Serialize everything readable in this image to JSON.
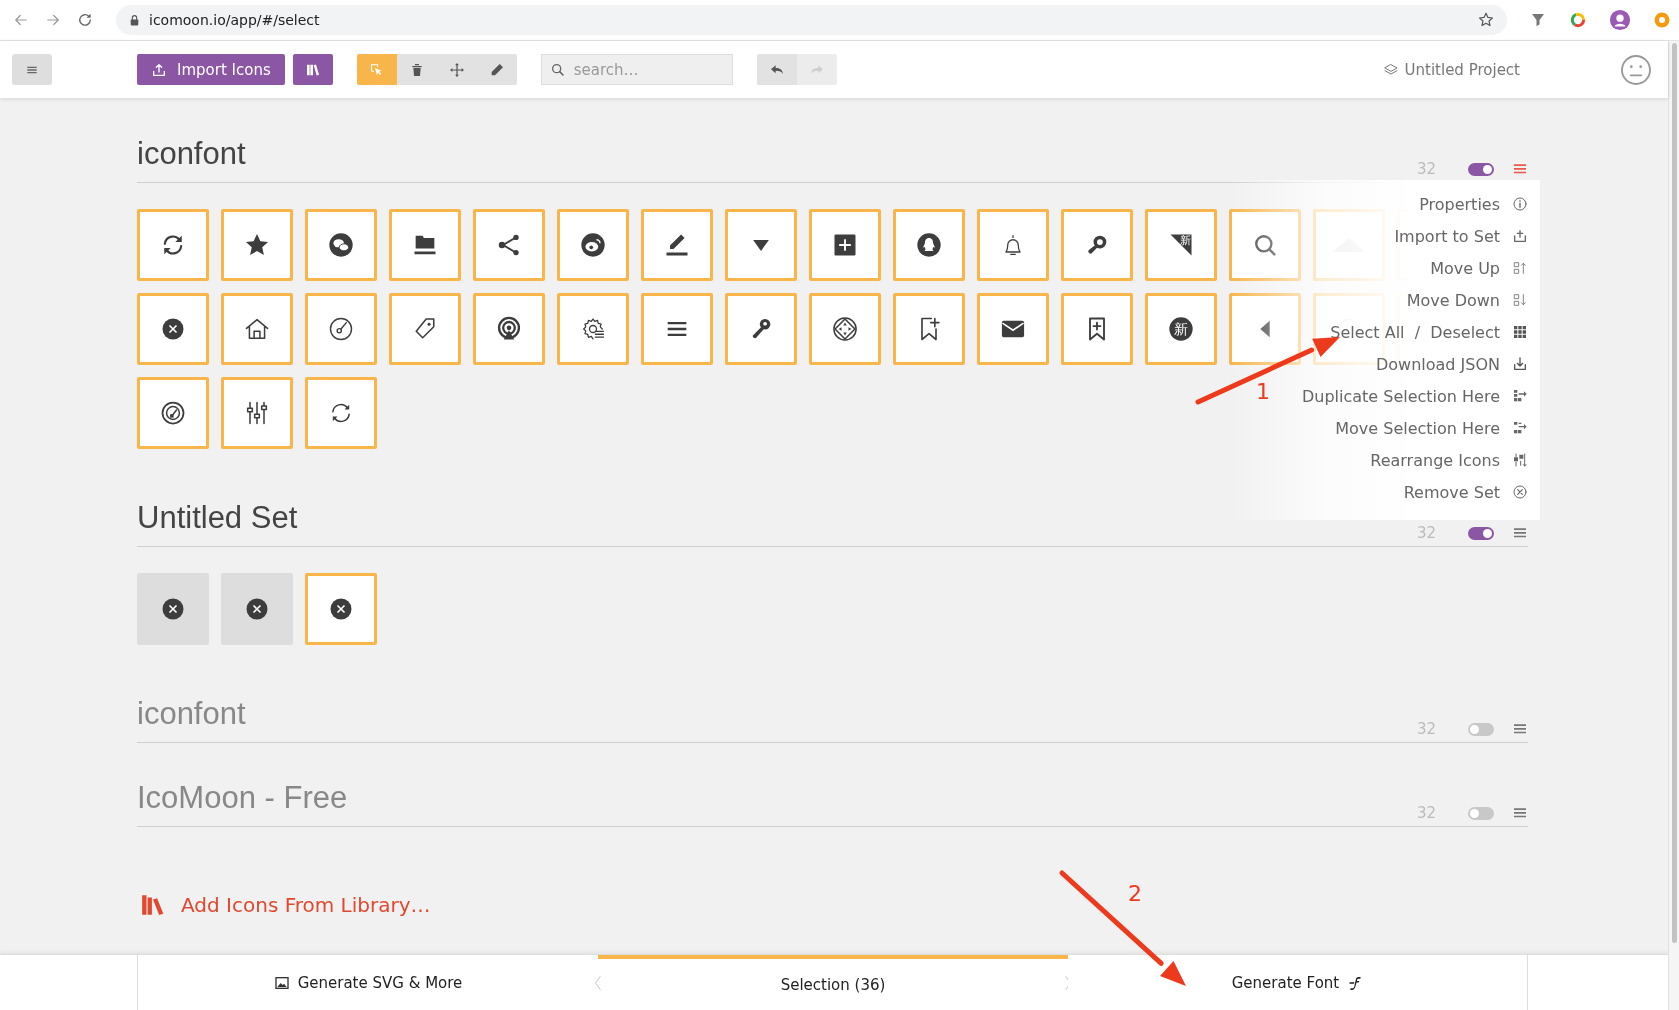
{
  "browser": {
    "url": "icomoon.io/app/#/select"
  },
  "toolbar": {
    "import_label": "Import Icons",
    "tools": [
      {
        "kind": "select",
        "selected": true
      },
      {
        "kind": "trash",
        "selected": false
      },
      {
        "kind": "move",
        "selected": false
      },
      {
        "kind": "edit",
        "selected": false
      }
    ],
    "search": {
      "placeholder": "search…"
    },
    "history": [
      {
        "kind": "undo",
        "disabled": false
      },
      {
        "kind": "redo",
        "disabled": true
      }
    ],
    "project": "Untitled Project"
  },
  "sets": [
    {
      "title": "iconfont",
      "count": "32",
      "enabled": true,
      "menu_open": true,
      "icons": [
        {
          "kind": "refresh",
          "selected": true
        },
        {
          "kind": "star",
          "selected": true
        },
        {
          "kind": "chat",
          "selected": true
        },
        {
          "kind": "inbox",
          "selected": true
        },
        {
          "kind": "share",
          "selected": true
        },
        {
          "kind": "weibo",
          "selected": true
        },
        {
          "kind": "editline",
          "selected": true
        },
        {
          "kind": "caretdown",
          "selected": true
        },
        {
          "kind": "plusbox",
          "selected": true
        },
        {
          "kind": "qq",
          "selected": true
        },
        {
          "kind": "bell",
          "selected": true
        },
        {
          "kind": "keysearch",
          "selected": true
        },
        {
          "kind": "corner",
          "glyph": "新",
          "selected": true
        },
        {
          "kind": "search",
          "selected": true
        },
        {
          "kind": "triup",
          "selected": true
        },
        {
          "kind": "covered",
          "selected": true
        },
        {
          "kind": "closecircle",
          "selected": true
        },
        {
          "kind": "home",
          "selected": true
        },
        {
          "kind": "gauge",
          "selected": true
        },
        {
          "kind": "tag",
          "selected": true
        },
        {
          "kind": "broadcast",
          "selected": true
        },
        {
          "kind": "gearlist",
          "selected": true
        },
        {
          "kind": "menu",
          "selected": true
        },
        {
          "kind": "key",
          "selected": true
        },
        {
          "kind": "compass",
          "selected": true
        },
        {
          "kind": "bookplus",
          "selected": true
        },
        {
          "kind": "mail",
          "selected": true
        },
        {
          "kind": "bookbox",
          "selected": true
        },
        {
          "kind": "badge",
          "glyph": "新",
          "selected": true
        },
        {
          "kind": "caretleft",
          "selected": true
        },
        {
          "kind": "ring",
          "selected": true
        },
        {
          "kind": "covered",
          "selected": true
        },
        {
          "kind": "gauge2",
          "selected": true
        },
        {
          "kind": "sliders",
          "selected": true
        },
        {
          "kind": "refresh2",
          "selected": true
        }
      ],
      "menu": [
        {
          "label": "Properties",
          "kind": "info"
        },
        {
          "label": "Import to Set",
          "kind": "importset"
        },
        {
          "label": "Move Up",
          "kind": "moveup"
        },
        {
          "label": "Move Down",
          "kind": "movedown"
        },
        {
          "label": "Select All  /  Deselect",
          "kind": "grid"
        },
        {
          "label": "Download JSON",
          "kind": "download"
        },
        {
          "label": "Duplicate Selection Here",
          "kind": "dup"
        },
        {
          "label": "Move Selection Here",
          "kind": "movesel"
        },
        {
          "label": "Rearrange Icons",
          "kind": "rearrange"
        },
        {
          "label": "Remove Set",
          "kind": "removeset"
        }
      ]
    },
    {
      "title": "Untitled Set",
      "count": "32",
      "enabled": true,
      "menu_open": false,
      "icons": [
        {
          "kind": "closecircle",
          "selected": false
        },
        {
          "kind": "closecircle",
          "selected": false
        },
        {
          "kind": "closecircle",
          "selected": true
        }
      ]
    },
    {
      "title": "iconfont",
      "count": "32",
      "enabled": false,
      "menu_open": false
    },
    {
      "title": "IcoMoon - Free",
      "count": "32",
      "enabled": false,
      "menu_open": false
    }
  ],
  "add_library": "Add Icons From Library…",
  "bottom_tabs": [
    {
      "label": "Generate SVG & More",
      "kind": "image",
      "selected": false
    },
    {
      "label": "Selection (36)",
      "kind": "selection",
      "selected": true
    },
    {
      "label": "Generate Font",
      "kind": "font",
      "selected": false
    }
  ],
  "annotations": [
    {
      "label": "1"
    },
    {
      "label": "2"
    }
  ]
}
